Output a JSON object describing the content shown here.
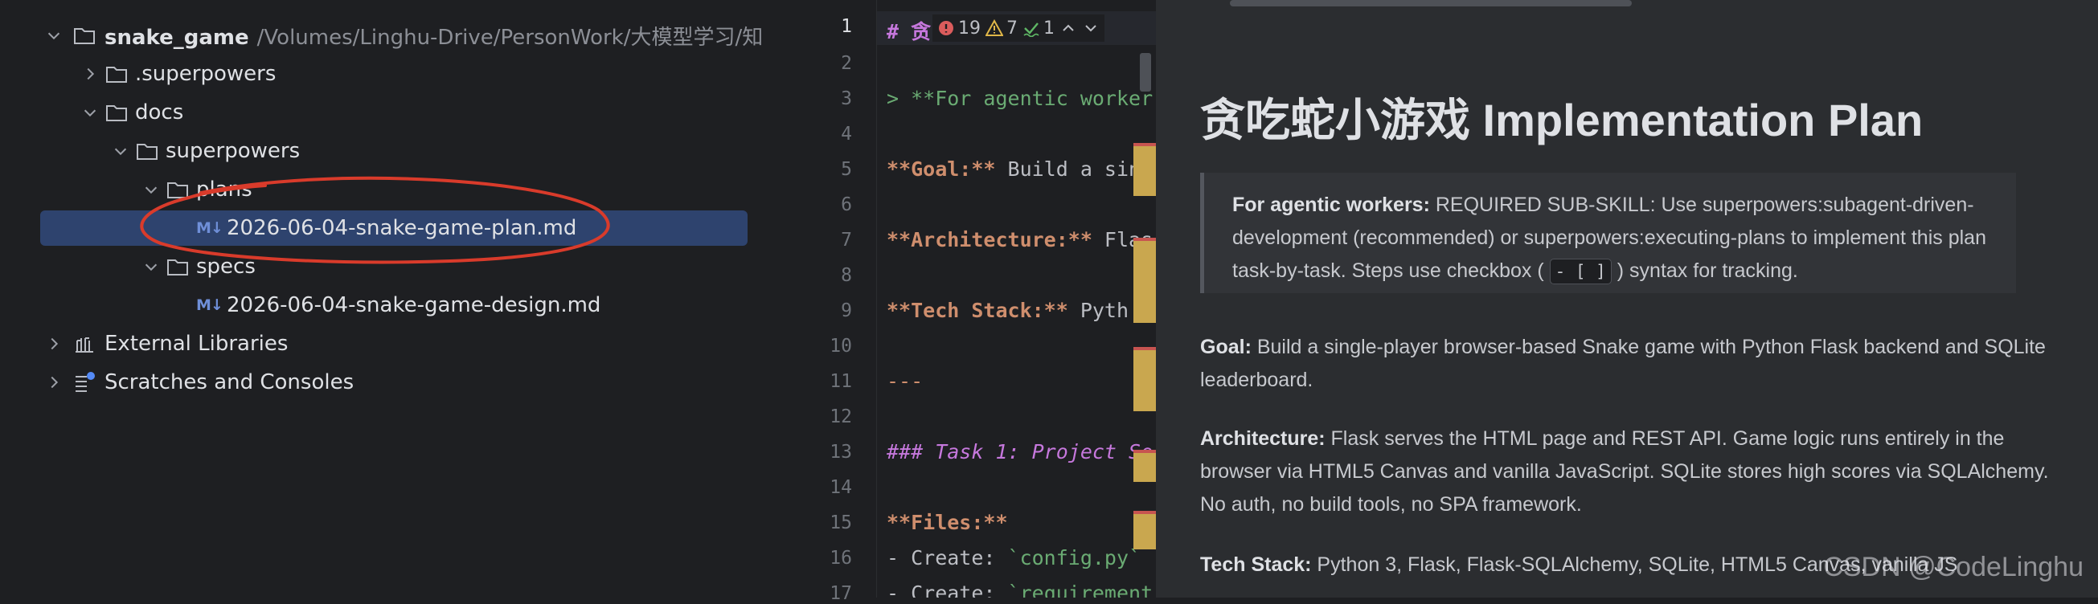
{
  "tree": {
    "root": {
      "name": "snake_game",
      "path": "/Volumes/Linghu-Drive/PersonWork/大模型学习/知识文"
    },
    "items": [
      {
        "label": ".superpowers"
      },
      {
        "label": "docs"
      },
      {
        "label": "superpowers"
      },
      {
        "label": "plans"
      },
      {
        "label": "2026-06-04-snake-game-plan.md",
        "badge": "M↓"
      },
      {
        "label": "specs"
      },
      {
        "label": "2026-06-04-snake-game-design.md",
        "badge": "M↓"
      },
      {
        "label": "External Libraries"
      },
      {
        "label": "Scratches and Consoles"
      }
    ]
  },
  "editor": {
    "line_numbers": [
      "1",
      "2",
      "3",
      "4",
      "5",
      "6",
      "7",
      "8",
      "9",
      "10",
      "11",
      "12",
      "13",
      "14",
      "15",
      "16",
      "17"
    ],
    "lines": {
      "l1": "# 贪",
      "l3": "> **For agentic worker",
      "l5a": "**Goal:**",
      "l5b": " Build a sing",
      "l7a": "**Architecture:**",
      "l7b": " Flas",
      "l9a": "**Tech Stack:**",
      "l9b": " Pyth",
      "l11": "---",
      "l13": "### Task 1: Project Se",
      "l15": "**Files:**",
      "l16a": "- Create: ",
      "l16b": "`config.py`",
      "l17a": "- Create: ",
      "l17b": "`requirement"
    },
    "inspections": {
      "errors": "19",
      "warnings": "7",
      "typos": "1"
    }
  },
  "preview": {
    "title": "贪吃蛇小游戏 Implementation Plan",
    "callout": {
      "bold": "For agentic workers:",
      "text_before": " REQUIRED SUB-SKILL: Use superpowers:subagent-driven-development (recommended) or superpowers:executing-plans to implement this plan task-by-task. Steps use checkbox ( ",
      "checkbox": "- [ ]",
      "text_after": " ) syntax for tracking."
    },
    "goal": {
      "label": "Goal:",
      "text": " Build a single-player browser-based Snake game with Python Flask backend and SQLite leaderboard."
    },
    "architecture": {
      "label": "Architecture:",
      "text": " Flask serves the HTML page and REST API. Game logic runs entirely in the browser via HTML5 Canvas and vanilla JavaScript. SQLite stores high scores via SQLAlchemy. No auth, no build tools, no SPA framework."
    },
    "tech_stack": {
      "label": "Tech Stack:",
      "text": " Python 3, Flask, Flask-SQLAlchemy, SQLite, HTML5 Canvas, vanilla JS"
    },
    "watermark": "CSDN @CodeLinghu"
  },
  "colors": {
    "selection": "#2e436e",
    "annotation": "#d93b2b",
    "heading": "#c678dd",
    "markdown_bold": "#cf8e6d",
    "marker": "#c9a74f"
  }
}
